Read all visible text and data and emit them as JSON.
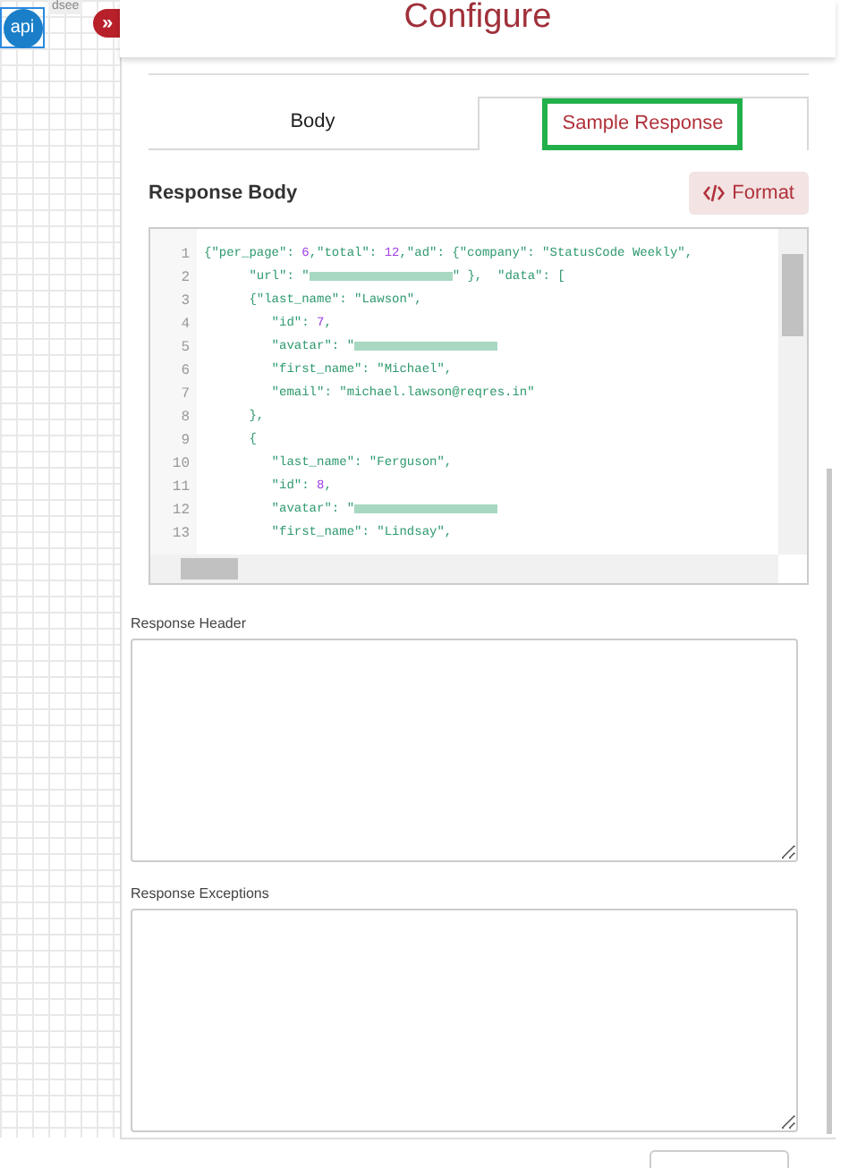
{
  "canvas": {
    "node": {
      "label": "api",
      "caption": "dsee",
      "selected": true
    },
    "toggle": {
      "symbol": "»"
    }
  },
  "panel": {
    "title": "Configure"
  },
  "tabs": [
    {
      "label": "Body",
      "selected": false,
      "highlighted": false
    },
    {
      "label": "Sample Response",
      "selected": true,
      "highlighted": true
    }
  ],
  "response_body": {
    "label": "Response Body",
    "format_button": "Format",
    "lines": [
      {
        "number": "1",
        "tokens": [
          {
            "t": "{\"per_page\": ",
            "kind": "str"
          },
          {
            "t": "6",
            "kind": "num"
          },
          {
            "t": ",\"total\": ",
            "kind": "str"
          },
          {
            "t": "12",
            "kind": "num"
          },
          {
            "t": ",\"ad\": {\"company\": \"StatusCode Weekly\",",
            "kind": "str"
          }
        ]
      },
      {
        "number": "2",
        "tokens": [
          {
            "t": "      \"url\": \"",
            "kind": "str"
          },
          {
            "kind": "blur"
          },
          {
            "t": "\" },  \"data\": [",
            "kind": "str"
          }
        ]
      },
      {
        "number": "3",
        "tokens": [
          {
            "t": "      {\"last_name\": \"Lawson\",",
            "kind": "str"
          }
        ]
      },
      {
        "number": "4",
        "tokens": [
          {
            "t": "         \"id\": ",
            "kind": "str"
          },
          {
            "t": "7",
            "kind": "num"
          },
          {
            "t": ",",
            "kind": "str"
          }
        ]
      },
      {
        "number": "5",
        "tokens": [
          {
            "t": "         \"avatar\": \"",
            "kind": "str"
          },
          {
            "kind": "blur"
          }
        ]
      },
      {
        "number": "6",
        "tokens": [
          {
            "t": "         \"first_name\": \"Michael\",",
            "kind": "str"
          }
        ]
      },
      {
        "number": "7",
        "tokens": [
          {
            "t": "         \"email\": \"michael.lawson@reqres.in\"",
            "kind": "str"
          }
        ]
      },
      {
        "number": "8",
        "tokens": [
          {
            "t": "      },",
            "kind": "str"
          }
        ]
      },
      {
        "number": "9",
        "tokens": [
          {
            "t": "      {",
            "kind": "str"
          }
        ]
      },
      {
        "number": "10",
        "tokens": [
          {
            "t": "         \"last_name\": \"Ferguson\",",
            "kind": "str"
          }
        ]
      },
      {
        "number": "11",
        "tokens": [
          {
            "t": "         \"id\": ",
            "kind": "str"
          },
          {
            "t": "8",
            "kind": "num"
          },
          {
            "t": ",",
            "kind": "str"
          }
        ]
      },
      {
        "number": "12",
        "tokens": [
          {
            "t": "         \"avatar\": \"",
            "kind": "str"
          },
          {
            "kind": "blur"
          }
        ]
      },
      {
        "number": "13",
        "tokens": [
          {
            "t": "         \"first_name\": \"Lindsay\",",
            "kind": "str"
          }
        ]
      }
    ]
  },
  "response_header": {
    "label": "Response Header"
  },
  "response_exceptions": {
    "label": "Response Exceptions"
  }
}
